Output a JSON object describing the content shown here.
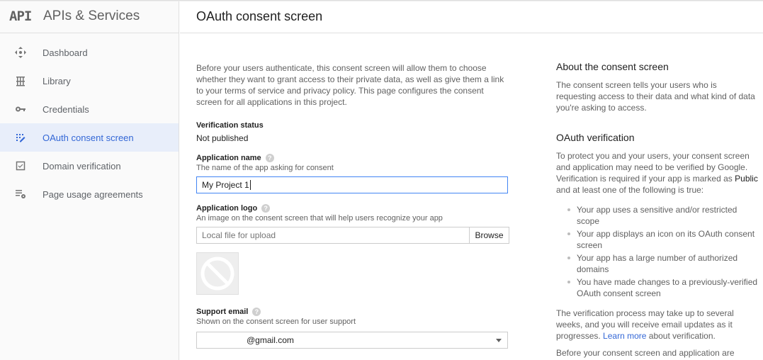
{
  "sidebar": {
    "logo": "API",
    "title": "APIs & Services",
    "items": [
      {
        "label": "Dashboard",
        "icon": "dashboard-icon",
        "active": false
      },
      {
        "label": "Library",
        "icon": "library-icon",
        "active": false
      },
      {
        "label": "Credentials",
        "icon": "key-icon",
        "active": false
      },
      {
        "label": "OAuth consent screen",
        "icon": "consent-icon",
        "active": true
      },
      {
        "label": "Domain verification",
        "icon": "checkbox-icon",
        "active": false
      },
      {
        "label": "Page usage agreements",
        "icon": "list-settings-icon",
        "active": false
      }
    ]
  },
  "header": {
    "title": "OAuth consent screen"
  },
  "form": {
    "intro": "Before your users authenticate, this consent screen will allow them to choose whether they want to grant access to their private data, as well as give them a link to your terms of service and privacy policy. This page configures the consent screen for all applications in this project.",
    "verification_label": "Verification status",
    "verification_value": "Not published",
    "app_name_label": "Application name",
    "app_name_sub": "The name of the app asking for consent",
    "app_name_value": "My Project 1",
    "logo_label": "Application logo",
    "logo_sub": "An image on the consent screen that will help users recognize your app",
    "logo_placeholder": "Local file for upload",
    "browse_label": "Browse",
    "support_label": "Support email",
    "support_sub": "Shown on the consent screen for user support",
    "support_value": "@gmail.com",
    "help_glyph": "?"
  },
  "right": {
    "about_title": "About the consent screen",
    "about_text": "The consent screen tells your users who is requesting access to their data and what kind of data you're asking to access.",
    "verif_title": "OAuth verification",
    "verif_text_1": "To protect you and your users, your consent screen and application may need to be verified by Google. Verification is required if your app is marked as",
    "verif_bold": "Public",
    "verif_text_2": "and at least one of the following is true:",
    "bullets": [
      "Your app uses a sensitive and/or restricted scope",
      "Your app displays an icon on its OAuth consent screen",
      "Your app has a large number of authorized domains",
      "You have made changes to a previously-verified OAuth consent screen"
    ],
    "process_text_1": "The verification process may take up to several weeks, and you will receive email updates as it progresses.",
    "learn_more": "Learn more",
    "process_text_2": "about verification.",
    "before_text": "Before your consent screen and application are"
  },
  "colors": {
    "accent": "#3367d6",
    "active_bg": "#e8eefa",
    "input_focus": "#4285f4"
  }
}
